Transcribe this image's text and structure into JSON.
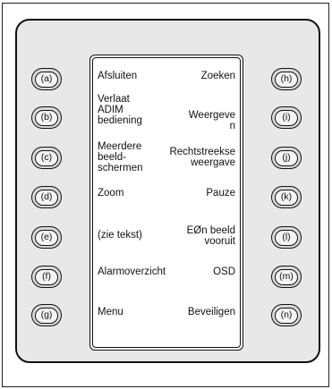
{
  "left_keys": [
    "(a)",
    "(b)",
    "(c)",
    "(d)",
    "(e)",
    "(f)",
    "(g)"
  ],
  "right_keys": [
    "(h)",
    "(i)",
    "(j)",
    "(k)",
    "(l)",
    "(m)",
    "(n)"
  ],
  "screen": {
    "left_labels": [
      [
        "Afsluiten"
      ],
      [
        "Verlaat",
        "ADIM",
        "bediening"
      ],
      [
        "Meerdere",
        "beeld-",
        "schermen"
      ],
      [
        "Zoom"
      ],
      [
        "(zie tekst)"
      ],
      [
        "Alarmoverzicht"
      ],
      [
        "Menu"
      ]
    ],
    "right_labels": [
      [
        "Zoeken"
      ],
      [
        "Weergeve",
        "n"
      ],
      [
        "Rechtstreekse",
        "weergave"
      ],
      [
        "Pauze"
      ],
      [
        "EØn beeld",
        "vooruit"
      ],
      [
        "OSD"
      ],
      [
        "Beveiligen"
      ]
    ]
  }
}
